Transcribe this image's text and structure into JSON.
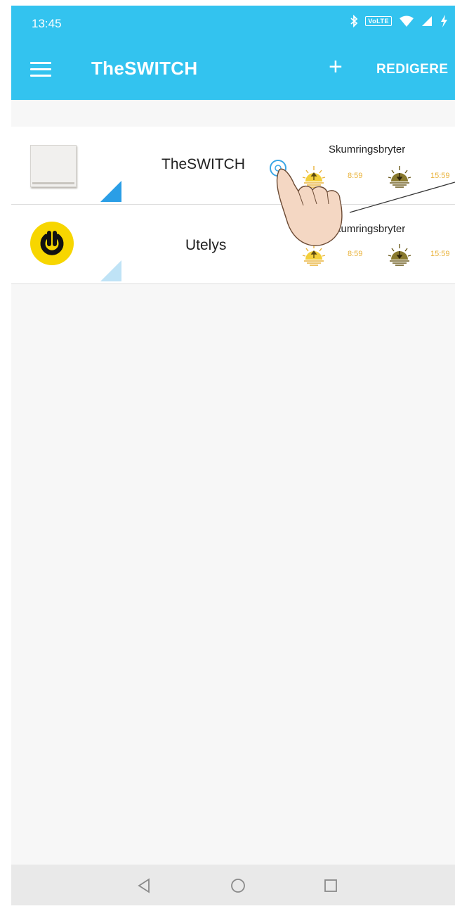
{
  "status_bar": {
    "time": "13:45",
    "volte": "VoLTE"
  },
  "app_bar": {
    "title": "TheSWITCH",
    "add_label": "+",
    "edit_label": "REDIGERE"
  },
  "devices": [
    {
      "name": "TheSWITCH",
      "mode": "Skumringsbryter",
      "sunrise": "8:59",
      "sunset": "15:59",
      "icon": "wall-switch-icon"
    },
    {
      "name": "Utelys",
      "mode": "Skumringsbryter",
      "sunrise": "8:59",
      "sunset": "15:59",
      "icon": "power-icon"
    }
  ],
  "colors": {
    "primary": "#33c3ef",
    "accent": "#f7d600",
    "time_text": "#e9b23a",
    "signal": "#2a9ee6"
  }
}
